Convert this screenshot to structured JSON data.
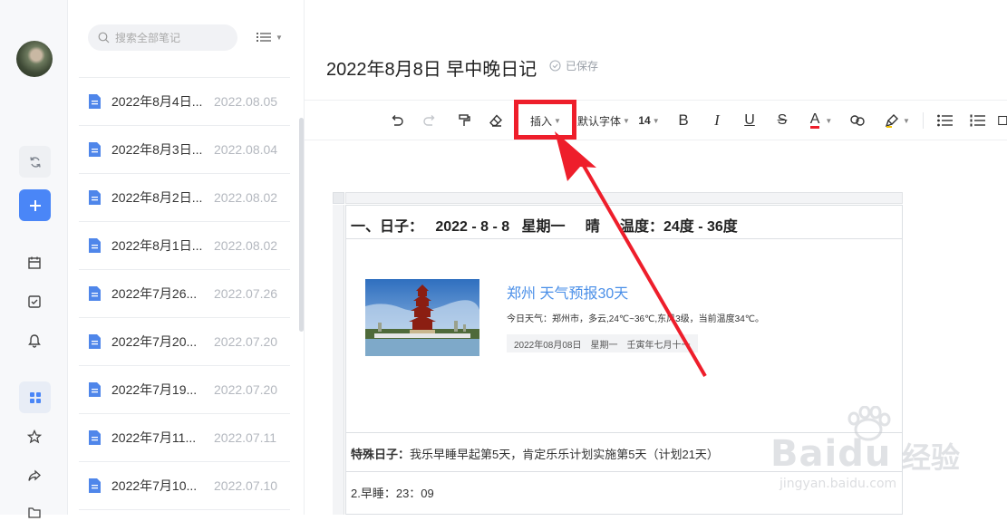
{
  "search": {
    "placeholder": "搜索全部笔记"
  },
  "notes": [
    {
      "title": "2022年8月4日...",
      "date": "2022.08.05"
    },
    {
      "title": "2022年8月3日...",
      "date": "2022.08.04"
    },
    {
      "title": "2022年8月2日...",
      "date": "2022.08.02"
    },
    {
      "title": "2022年8月1日...",
      "date": "2022.08.02"
    },
    {
      "title": "2022年7月26...",
      "date": "2022.07.26"
    },
    {
      "title": "2022年7月20...",
      "date": "2022.07.20"
    },
    {
      "title": "2022年7月19...",
      "date": "2022.07.20"
    },
    {
      "title": "2022年7月11...",
      "date": "2022.07.11"
    },
    {
      "title": "2022年7月10...",
      "date": "2022.07.10"
    }
  ],
  "editor": {
    "title": "2022年8月8日 早中晚日记",
    "saved_label": "已保存"
  },
  "toolbar": {
    "insert_label": "插入",
    "font_label": "默认字体",
    "size_label": "14",
    "bold": "B",
    "italic": "I",
    "underline": "U",
    "strike": "S",
    "font_color": "A"
  },
  "table": {
    "row1": "一、日子：   2022 - 8 - 8   星期一     晴     温度：24度 - 36度",
    "weather_title": "郑州 天气预报30天",
    "weather_desc": "今日天气：郑州市，多云,24℃~36℃,东风3级，当前温度34℃。",
    "weather_date": "2022年08月08日",
    "weather_weekday": "星期一",
    "weather_lunar": "壬寅年七月十一",
    "row3_label": "特殊日子：",
    "row3_text": "我乐早睡早起第5天，肯定乐乐计划实施第5天（计划21天）",
    "row4": "2.早睡：23：09"
  },
  "watermark": {
    "logo": "Baidu",
    "cn": "经验",
    "url": "jingyan.baidu.com"
  },
  "colors": {
    "accent": "#4a86f7",
    "highlight": "#ee1e2b",
    "link": "#4a8fe8"
  }
}
